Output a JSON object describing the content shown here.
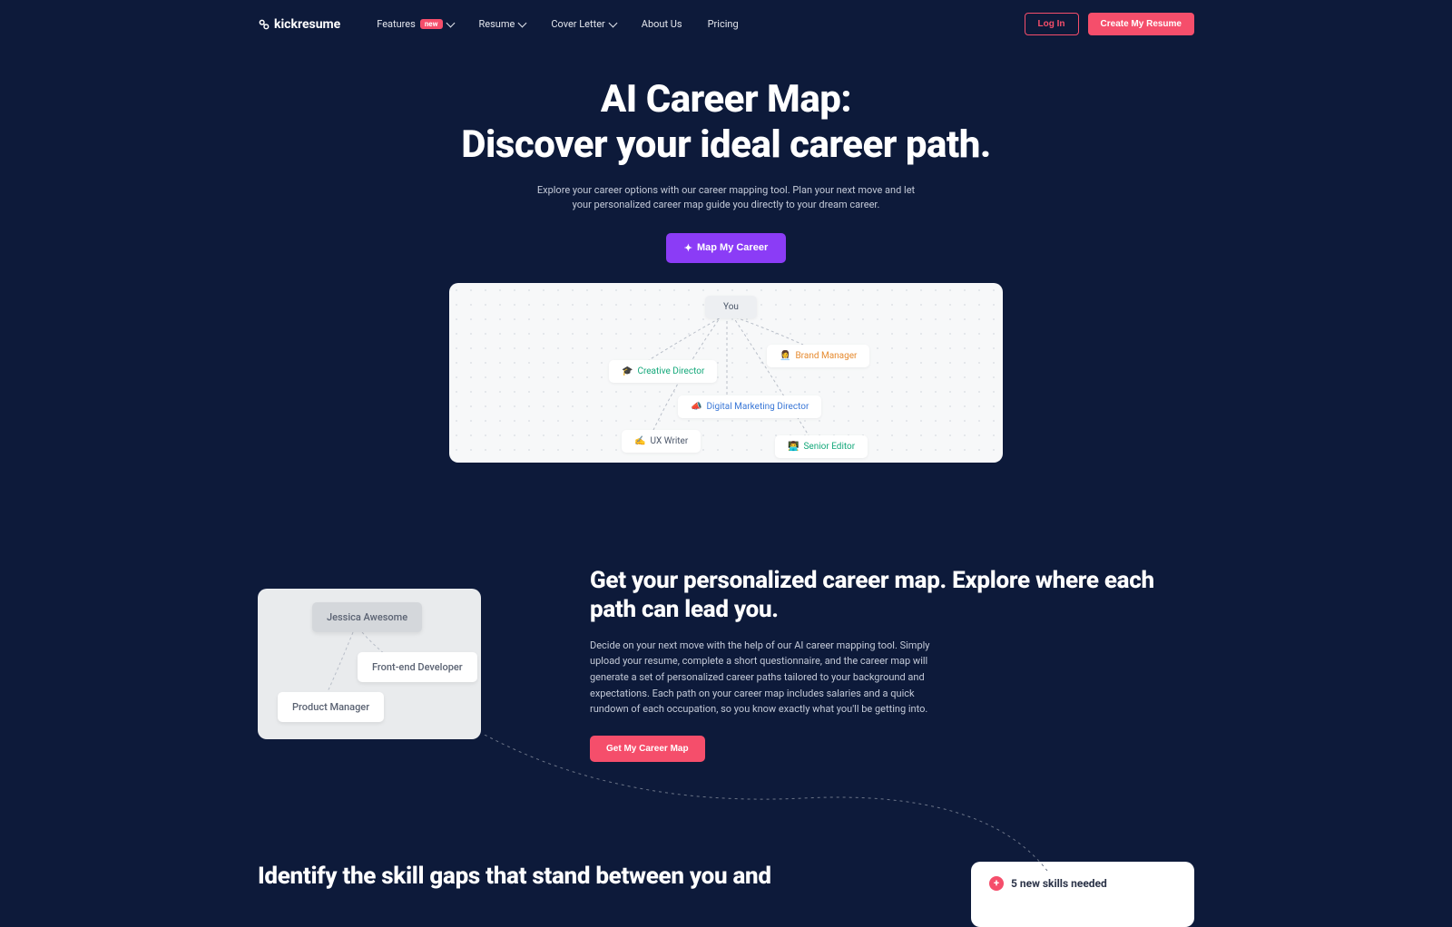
{
  "brand": "kickresume",
  "nav": {
    "features": "Features",
    "features_badge": "new",
    "resume": "Resume",
    "cover_letter": "Cover Letter",
    "about": "About Us",
    "pricing": "Pricing",
    "login": "Log In",
    "create": "Create My Resume"
  },
  "hero": {
    "title_line1": "AI Career Map:",
    "title_line2": "Discover your ideal career path.",
    "subtitle": "Explore your career options with our career mapping tool. Plan your next move and let your personalized career map guide you directly to your dream career.",
    "cta": "Map My Career"
  },
  "map_nodes": {
    "you": "You",
    "creative_director": "Creative Director",
    "brand_manager": "Brand Manager",
    "digital_marketing": "Digital Marketing Director",
    "ux_writer": "UX Writer",
    "senior_editor": "Senior Editor"
  },
  "map_emojis": {
    "creative": "🎓",
    "brand": "👩‍💼",
    "digital": "📣",
    "ux": "✍️",
    "senior": "👨‍💻"
  },
  "section1": {
    "heading": "Get your personalized career map. Explore where each path can lead you.",
    "body": "Decide on your next move with the help of our AI career mapping tool. Simply upload your resume, complete a short questionnaire, and the career map will generate a set of personalized career paths tailored to your background and expectations. Each path on your career map includes salaries and a quick rundown of each occupation, so you know exactly what you'll be getting into.",
    "cta": "Get My Career Map",
    "card_nodes": {
      "name": "Jessica Awesome",
      "role1": "Front-end Developer",
      "role2": "Product Manager"
    }
  },
  "section2": {
    "heading": "Identify the skill gaps that stand between you and",
    "skills_label": "5 new skills needed"
  }
}
